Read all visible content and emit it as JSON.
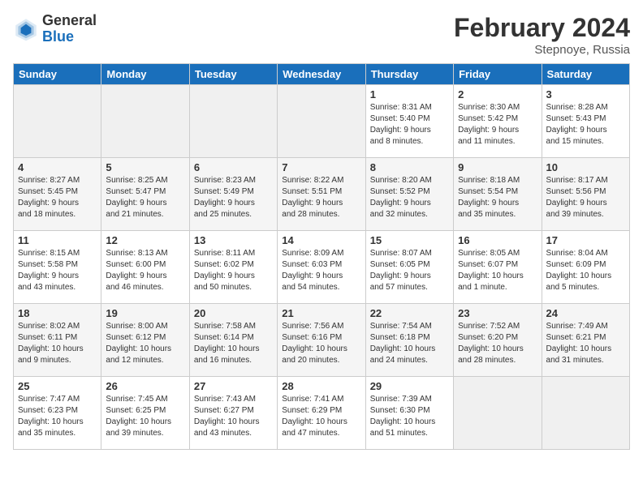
{
  "header": {
    "logo_general": "General",
    "logo_blue": "Blue",
    "title": "February 2024",
    "subtitle": "Stepnoye, Russia"
  },
  "weekdays": [
    "Sunday",
    "Monday",
    "Tuesday",
    "Wednesday",
    "Thursday",
    "Friday",
    "Saturday"
  ],
  "weeks": [
    [
      {
        "day": "",
        "info": ""
      },
      {
        "day": "",
        "info": ""
      },
      {
        "day": "",
        "info": ""
      },
      {
        "day": "",
        "info": ""
      },
      {
        "day": "1",
        "info": "Sunrise: 8:31 AM\nSunset: 5:40 PM\nDaylight: 9 hours\nand 8 minutes."
      },
      {
        "day": "2",
        "info": "Sunrise: 8:30 AM\nSunset: 5:42 PM\nDaylight: 9 hours\nand 11 minutes."
      },
      {
        "day": "3",
        "info": "Sunrise: 8:28 AM\nSunset: 5:43 PM\nDaylight: 9 hours\nand 15 minutes."
      }
    ],
    [
      {
        "day": "4",
        "info": "Sunrise: 8:27 AM\nSunset: 5:45 PM\nDaylight: 9 hours\nand 18 minutes."
      },
      {
        "day": "5",
        "info": "Sunrise: 8:25 AM\nSunset: 5:47 PM\nDaylight: 9 hours\nand 21 minutes."
      },
      {
        "day": "6",
        "info": "Sunrise: 8:23 AM\nSunset: 5:49 PM\nDaylight: 9 hours\nand 25 minutes."
      },
      {
        "day": "7",
        "info": "Sunrise: 8:22 AM\nSunset: 5:51 PM\nDaylight: 9 hours\nand 28 minutes."
      },
      {
        "day": "8",
        "info": "Sunrise: 8:20 AM\nSunset: 5:52 PM\nDaylight: 9 hours\nand 32 minutes."
      },
      {
        "day": "9",
        "info": "Sunrise: 8:18 AM\nSunset: 5:54 PM\nDaylight: 9 hours\nand 35 minutes."
      },
      {
        "day": "10",
        "info": "Sunrise: 8:17 AM\nSunset: 5:56 PM\nDaylight: 9 hours\nand 39 minutes."
      }
    ],
    [
      {
        "day": "11",
        "info": "Sunrise: 8:15 AM\nSunset: 5:58 PM\nDaylight: 9 hours\nand 43 minutes."
      },
      {
        "day": "12",
        "info": "Sunrise: 8:13 AM\nSunset: 6:00 PM\nDaylight: 9 hours\nand 46 minutes."
      },
      {
        "day": "13",
        "info": "Sunrise: 8:11 AM\nSunset: 6:02 PM\nDaylight: 9 hours\nand 50 minutes."
      },
      {
        "day": "14",
        "info": "Sunrise: 8:09 AM\nSunset: 6:03 PM\nDaylight: 9 hours\nand 54 minutes."
      },
      {
        "day": "15",
        "info": "Sunrise: 8:07 AM\nSunset: 6:05 PM\nDaylight: 9 hours\nand 57 minutes."
      },
      {
        "day": "16",
        "info": "Sunrise: 8:05 AM\nSunset: 6:07 PM\nDaylight: 10 hours\nand 1 minute."
      },
      {
        "day": "17",
        "info": "Sunrise: 8:04 AM\nSunset: 6:09 PM\nDaylight: 10 hours\nand 5 minutes."
      }
    ],
    [
      {
        "day": "18",
        "info": "Sunrise: 8:02 AM\nSunset: 6:11 PM\nDaylight: 10 hours\nand 9 minutes."
      },
      {
        "day": "19",
        "info": "Sunrise: 8:00 AM\nSunset: 6:12 PM\nDaylight: 10 hours\nand 12 minutes."
      },
      {
        "day": "20",
        "info": "Sunrise: 7:58 AM\nSunset: 6:14 PM\nDaylight: 10 hours\nand 16 minutes."
      },
      {
        "day": "21",
        "info": "Sunrise: 7:56 AM\nSunset: 6:16 PM\nDaylight: 10 hours\nand 20 minutes."
      },
      {
        "day": "22",
        "info": "Sunrise: 7:54 AM\nSunset: 6:18 PM\nDaylight: 10 hours\nand 24 minutes."
      },
      {
        "day": "23",
        "info": "Sunrise: 7:52 AM\nSunset: 6:20 PM\nDaylight: 10 hours\nand 28 minutes."
      },
      {
        "day": "24",
        "info": "Sunrise: 7:49 AM\nSunset: 6:21 PM\nDaylight: 10 hours\nand 31 minutes."
      }
    ],
    [
      {
        "day": "25",
        "info": "Sunrise: 7:47 AM\nSunset: 6:23 PM\nDaylight: 10 hours\nand 35 minutes."
      },
      {
        "day": "26",
        "info": "Sunrise: 7:45 AM\nSunset: 6:25 PM\nDaylight: 10 hours\nand 39 minutes."
      },
      {
        "day": "27",
        "info": "Sunrise: 7:43 AM\nSunset: 6:27 PM\nDaylight: 10 hours\nand 43 minutes."
      },
      {
        "day": "28",
        "info": "Sunrise: 7:41 AM\nSunset: 6:29 PM\nDaylight: 10 hours\nand 47 minutes."
      },
      {
        "day": "29",
        "info": "Sunrise: 7:39 AM\nSunset: 6:30 PM\nDaylight: 10 hours\nand 51 minutes."
      },
      {
        "day": "",
        "info": ""
      },
      {
        "day": "",
        "info": ""
      }
    ]
  ]
}
